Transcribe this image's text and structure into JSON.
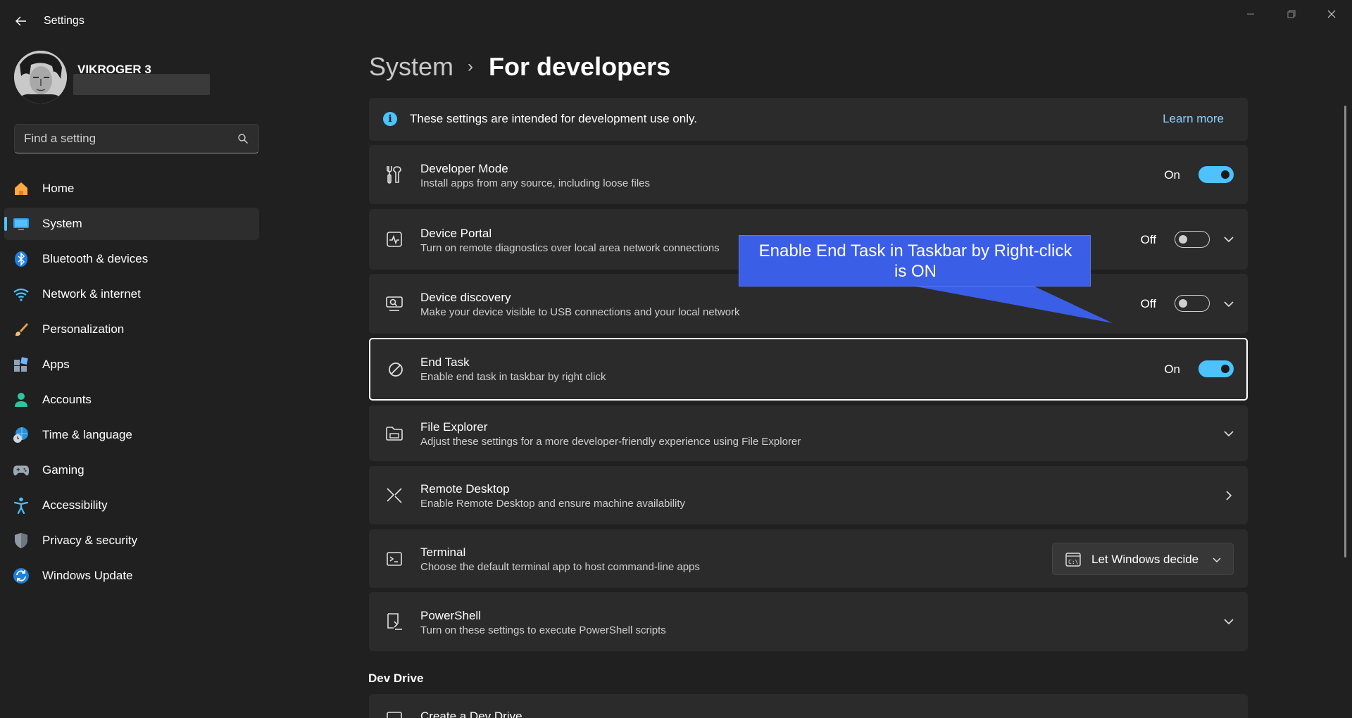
{
  "window": {
    "app_title": "Settings"
  },
  "profile": {
    "user_name": "VIKROGER 3"
  },
  "search": {
    "placeholder": "Find a setting"
  },
  "sidebar": {
    "items": [
      {
        "label": "Home",
        "icon": "home-icon",
        "active": false
      },
      {
        "label": "System",
        "icon": "system-icon",
        "active": true
      },
      {
        "label": "Bluetooth & devices",
        "icon": "bluetooth-icon",
        "active": false
      },
      {
        "label": "Network & internet",
        "icon": "wifi-icon",
        "active": false
      },
      {
        "label": "Personalization",
        "icon": "brush-icon",
        "active": false
      },
      {
        "label": "Apps",
        "icon": "apps-icon",
        "active": false
      },
      {
        "label": "Accounts",
        "icon": "person-icon",
        "active": false
      },
      {
        "label": "Time & language",
        "icon": "globe-clock-icon",
        "active": false
      },
      {
        "label": "Gaming",
        "icon": "gamepad-icon",
        "active": false
      },
      {
        "label": "Accessibility",
        "icon": "accessibility-icon",
        "active": false
      },
      {
        "label": "Privacy & security",
        "icon": "shield-icon",
        "active": false
      },
      {
        "label": "Windows Update",
        "icon": "update-icon",
        "active": false
      }
    ]
  },
  "breadcrumb": {
    "parent": "System",
    "separator": "›",
    "current": "For developers"
  },
  "info_banner": {
    "text": "These settings are intended for development use only.",
    "link": "Learn more"
  },
  "settings": {
    "developer_mode": {
      "title": "Developer Mode",
      "desc": "Install apps from any source, including loose files",
      "state": "On"
    },
    "device_portal": {
      "title": "Device Portal",
      "desc": "Turn on remote diagnostics over local area network connections",
      "state": "Off"
    },
    "device_discovery": {
      "title": "Device discovery",
      "desc": "Make your device visible to USB connections and your local network",
      "state": "Off"
    },
    "end_task": {
      "title": "End Task",
      "desc": "Enable end task in taskbar by right click",
      "state": "On"
    },
    "file_explorer": {
      "title": "File Explorer",
      "desc": "Adjust these settings for a more developer-friendly experience using File Explorer"
    },
    "remote_desktop": {
      "title": "Remote Desktop",
      "desc": "Enable Remote Desktop and ensure machine availability"
    },
    "terminal": {
      "title": "Terminal",
      "desc": "Choose the default terminal app to host command-line apps",
      "dropdown_value": "Let Windows decide"
    },
    "powershell": {
      "title": "PowerShell",
      "desc": "Turn on these settings to execute PowerShell scripts"
    }
  },
  "dev_drive": {
    "section_title": "Dev Drive",
    "first_item": "Create a Dev Drive"
  },
  "callout": {
    "line1": "Enable End Task in Taskbar by Right-click",
    "line2": "is ON"
  },
  "colors": {
    "accent": "#4cc2ff",
    "background": "#202020",
    "card": "#2b2b2b",
    "callout": "#3b5ee6"
  }
}
